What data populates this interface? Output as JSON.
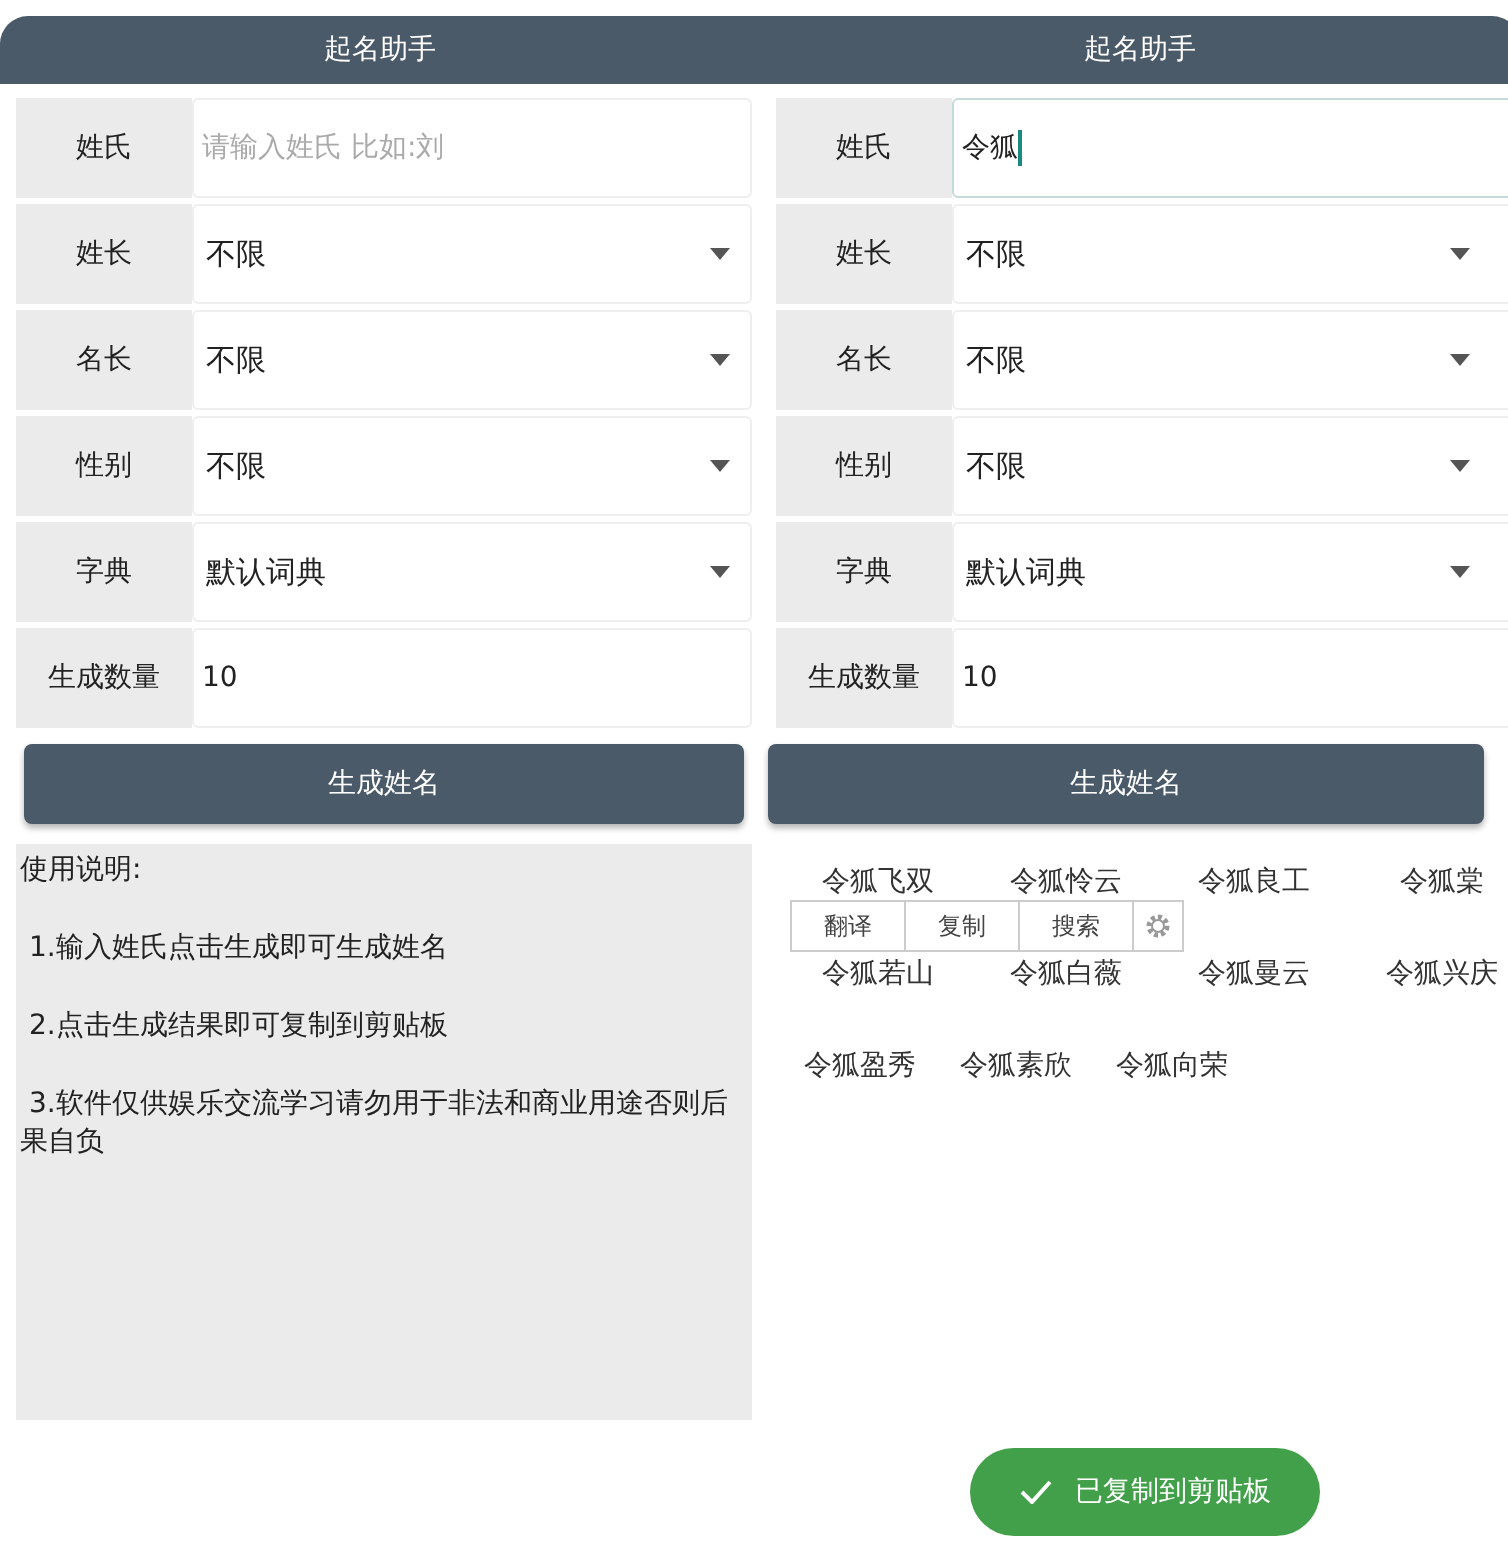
{
  "panels": [
    {
      "title": "起名助手",
      "fields": [
        {
          "kind": "text",
          "label": "姓氏",
          "placeholder": "请输入姓氏 比如:刘",
          "focused": false
        },
        {
          "kind": "select",
          "label": "姓长",
          "value": "不限"
        },
        {
          "kind": "select",
          "label": "名长",
          "value": "不限"
        },
        {
          "kind": "select",
          "label": "性别",
          "value": "不限"
        },
        {
          "kind": "select",
          "label": "字典",
          "value": "默认词典"
        },
        {
          "kind": "text",
          "label": "生成数量",
          "value": "10",
          "focused": false
        }
      ],
      "button": "生成姓名",
      "instructions": [
        "使用说明:",
        " 1.输入姓氏点击生成即可生成姓名",
        " 2.点击生成结果即可复制到剪贴板",
        " 3.软件仅供娱乐交流学习请勿用于非法和商业用途否则后果自负"
      ]
    },
    {
      "title": "起名助手",
      "fields": [
        {
          "kind": "text",
          "label": "姓氏",
          "value": "令狐",
          "focused": true
        },
        {
          "kind": "select",
          "label": "姓长",
          "value": "不限"
        },
        {
          "kind": "select",
          "label": "名长",
          "value": "不限"
        },
        {
          "kind": "select",
          "label": "性别",
          "value": "不限"
        },
        {
          "kind": "select",
          "label": "字典",
          "value": "默认词典"
        },
        {
          "kind": "text",
          "label": "生成数量",
          "value": "10",
          "focused": false
        }
      ],
      "button": "生成姓名",
      "results": [
        [
          "令狐飞双",
          "令狐怜云",
          "令狐良工",
          "令狐棠"
        ],
        [
          "令狐若山",
          "令狐白薇",
          "令狐曼云",
          "令狐兴庆"
        ],
        [
          "令狐盈秀",
          "令狐素欣",
          "令狐向荣"
        ]
      ],
      "context_menu": {
        "items": [
          "翻译",
          "复制",
          "搜索"
        ]
      }
    }
  ],
  "toast": {
    "text": "已复制到剪贴板"
  }
}
